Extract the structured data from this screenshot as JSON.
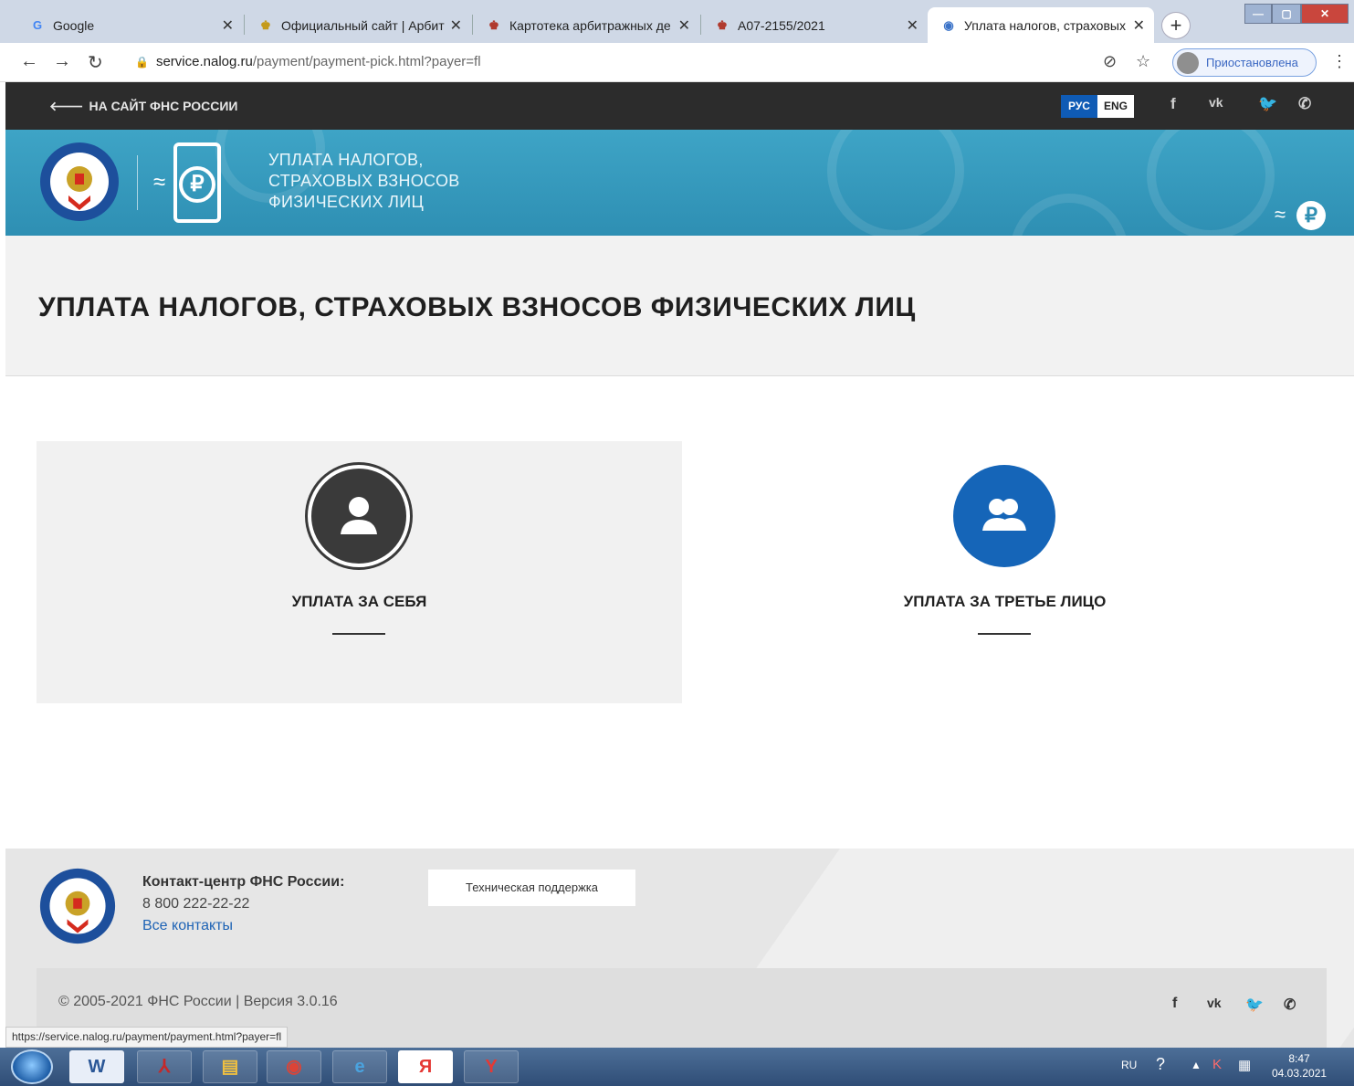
{
  "browser": {
    "tabs": [
      {
        "title": "Google",
        "favicon": "google-icon"
      },
      {
        "title": "Официальный сайт | Арбит",
        "favicon": "emblem-icon"
      },
      {
        "title": "Картотека арбитражных де",
        "favicon": "emblem-icon"
      },
      {
        "title": "А07-2155/2021",
        "favicon": "emblem-icon"
      },
      {
        "title": "Уплата налогов, страховых",
        "favicon": "globe-icon"
      }
    ],
    "url_host": "service.nalog.ru",
    "url_path": "/payment/payment-pick.html?payer=fl",
    "profile_status": "Приостановлена",
    "status_url": "https://service.nalog.ru/payment/payment.html?payer=fl"
  },
  "topbar": {
    "back_link": "НА САЙТ ФНС РОССИИ",
    "lang_rus": "РУС",
    "lang_eng": "ENG"
  },
  "banner": {
    "title_line1": "УПЛАТА НАЛОГОВ,",
    "title_line2": "СТРАХОВЫХ ВЗНОСОВ",
    "title_line3": "ФИЗИЧЕСКИХ ЛИЦ"
  },
  "page": {
    "title": "УПЛАТА НАЛОГОВ, СТРАХОВЫХ ВЗНОСОВ ФИЗИЧЕСКИХ ЛИЦ"
  },
  "options": [
    {
      "label": "УПЛАТА ЗА СЕБЯ",
      "icon": "user-icon"
    },
    {
      "label": "УПЛАТА ЗА ТРЕТЬЕ ЛИЦО",
      "icon": "users-icon"
    }
  ],
  "footer": {
    "contact_title": "Контакт-центр ФНС России:",
    "contact_phone": "8 800 222-22-22",
    "contacts_link": "Все контакты",
    "support_button": "Техническая поддержка",
    "copyright": "© 2005-2021 ФНС России   |   Версия 3.0.16"
  },
  "taskbar": {
    "lang": "RU",
    "time": "8:47",
    "date": "04.03.2021"
  },
  "colors": {
    "topbar": "#2c2c2c",
    "banner": "#3ea4c6",
    "accent_blue": "#1565b8",
    "lang_active": "#0f5bb5"
  }
}
